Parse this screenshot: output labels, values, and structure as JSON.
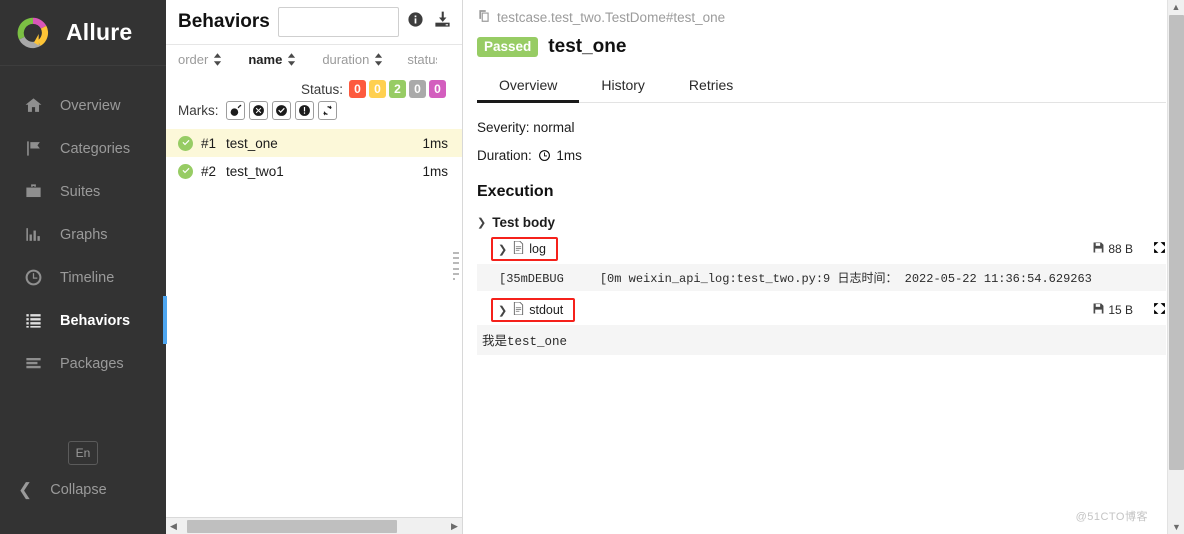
{
  "brand": {
    "name": "Allure",
    "logo_icon": "allure-logo-icon"
  },
  "sidebar": {
    "items": [
      {
        "label": "Overview",
        "icon": "home-icon",
        "active": false
      },
      {
        "label": "Categories",
        "icon": "flag-icon",
        "active": false
      },
      {
        "label": "Suites",
        "icon": "briefcase-icon",
        "active": false
      },
      {
        "label": "Graphs",
        "icon": "bar-chart-icon",
        "active": false
      },
      {
        "label": "Timeline",
        "icon": "clock-icon",
        "active": false
      },
      {
        "label": "Behaviors",
        "icon": "list-icon",
        "active": true
      },
      {
        "label": "Packages",
        "icon": "layers-icon",
        "active": false
      }
    ],
    "language_button": "En",
    "collapse_label": "Collapse",
    "collapse_icon": "chevron-left-icon",
    "accent_color": "#4ea6f0"
  },
  "middle": {
    "title": "Behaviors",
    "search_value": "",
    "search_placeholder": "",
    "info_icon": "info-icon",
    "export_icon": "download-icon",
    "sort_columns": [
      {
        "label": "order",
        "selected": false
      },
      {
        "label": "name",
        "selected": true
      },
      {
        "label": "duration",
        "selected": false
      },
      {
        "label": "status",
        "selected": false
      }
    ],
    "status_label": "Status:",
    "status_badges": [
      {
        "value": "0",
        "color": "#fd5a3e",
        "name": "failed"
      },
      {
        "value": "0",
        "color": "#ffd050",
        "name": "broken"
      },
      {
        "value": "2",
        "color": "#97cc64",
        "name": "passed"
      },
      {
        "value": "0",
        "color": "#aaaaaa",
        "name": "skipped"
      },
      {
        "value": "0",
        "color": "#d35ebe",
        "name": "unknown"
      }
    ],
    "marks_label": "Marks:",
    "marks": [
      {
        "icon": "bomb-icon"
      },
      {
        "icon": "x-circle-icon"
      },
      {
        "icon": "check-circle-icon"
      },
      {
        "icon": "exclamation-circle-icon"
      },
      {
        "icon": "retry-icon"
      }
    ],
    "tests": [
      {
        "order": "#1",
        "name": "test_one",
        "duration": "1ms",
        "status": "passed",
        "selected": true
      },
      {
        "order": "#2",
        "name": "test_two1",
        "duration": "1ms",
        "status": "passed",
        "selected": false
      }
    ],
    "hscroll_left_arrow": "◀",
    "hscroll_right_arrow": "▶"
  },
  "detail": {
    "breadcrumb": "testcase.test_two.TestDome#test_one",
    "breadcrumb_icon": "copy-icon",
    "status_label": "Passed",
    "status_color": "#97cc64",
    "case_name": "test_one",
    "tabs": [
      {
        "label": "Overview",
        "active": true
      },
      {
        "label": "History",
        "active": false
      },
      {
        "label": "Retries",
        "active": false
      }
    ],
    "severity_line": "Severity: normal",
    "duration_prefix": "Duration:",
    "duration_value": "1ms",
    "duration_icon": "clock-icon",
    "execution_heading": "Execution",
    "test_body_label": "Test body",
    "chevron_icon": "chevron-down-icon",
    "attachments": [
      {
        "name": "log",
        "size": "88 B",
        "file_icon": "document-icon",
        "save_icon": "floppy-disk-icon",
        "expand_icon": "expand-icon",
        "content": "[35mDEBUG     [0m weixin_api_log:test_two.py:9 日志时间： 2022-05-22 11:36:54.629263",
        "highlight_color": "#f5211b"
      },
      {
        "name": "stdout",
        "size": "15 B",
        "file_icon": "document-icon",
        "save_icon": "floppy-disk-icon",
        "expand_icon": "expand-icon",
        "content": "我是test_one",
        "highlight_color": "#f5211b"
      }
    ],
    "vscroll_up_arrow": "▲",
    "vscroll_down_arrow": "▼"
  },
  "watermark": "@51CTO博客"
}
